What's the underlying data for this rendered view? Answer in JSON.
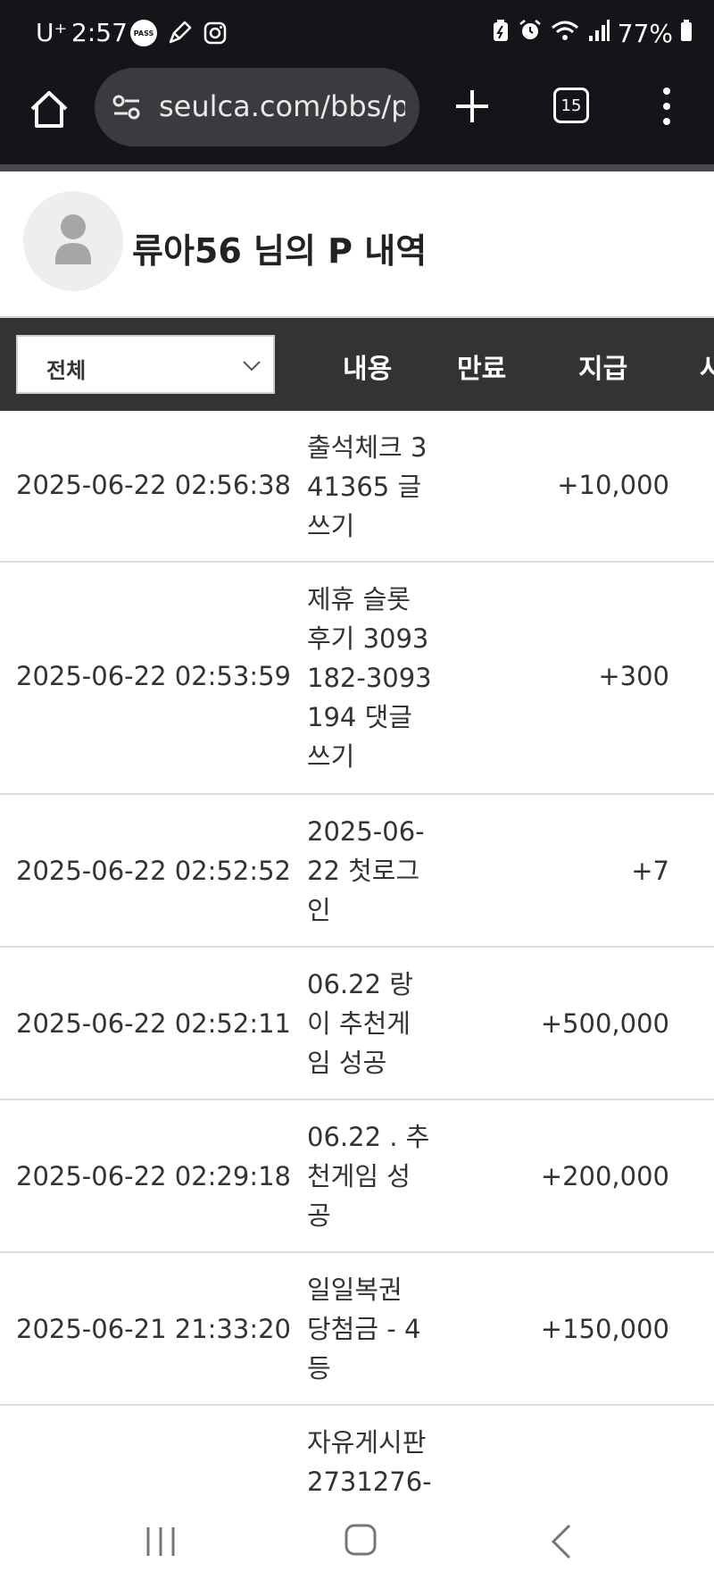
{
  "status_bar": {
    "carrier": "U⁺",
    "time": "2:57",
    "pass_badge": "PASS",
    "battery": "77%"
  },
  "browser": {
    "url": "seulca.com/bbs/p",
    "tab_count": "15"
  },
  "profile": {
    "title": "류아56 님의 P 내역"
  },
  "table": {
    "filter_selected": "전체",
    "headers": {
      "content": "내용",
      "expiry": "만료",
      "payment": "지급",
      "extra": "사"
    },
    "rows": [
      {
        "date": "2025-06-22 02:56:38",
        "content": "출석체크 341365 글쓰기",
        "amount": "+10,000"
      },
      {
        "date": "2025-06-22 02:53:59",
        "content": "제휴 슬롯 후기 3093182-3093194 댓글쓰기",
        "amount": "+300"
      },
      {
        "date": "2025-06-22 02:52:52",
        "content": "2025-06-22 첫로그인",
        "amount": "+7"
      },
      {
        "date": "2025-06-22 02:52:11",
        "content": "06.22 랑이 추천게임 성공",
        "amount": "+500,000"
      },
      {
        "date": "2025-06-22 02:29:18",
        "content": "06.22 . 추천게임 성공",
        "amount": "+200,000"
      },
      {
        "date": "2025-06-21 21:33:20",
        "content": "일일복권 당첨금 - 4등",
        "amount": "+150,000"
      },
      {
        "date": "",
        "content": "자유게시판 2731276-",
        "amount": ""
      }
    ]
  }
}
